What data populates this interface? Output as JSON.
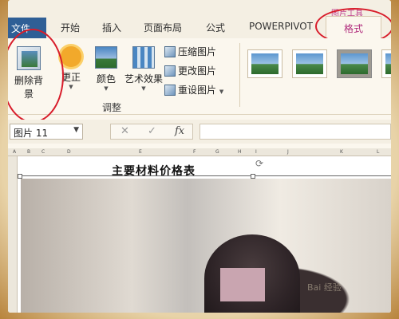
{
  "tabs": {
    "file": "文件",
    "home": "开始",
    "insert": "插入",
    "page_layout": "页面布局",
    "formulas": "公式",
    "powerpivot": "POWERPIVOT",
    "format": "格式",
    "context_title": "图片工具"
  },
  "ribbon": {
    "remove_background": "删除背景",
    "corrections": "更正",
    "color": "颜色",
    "artistic_effects": "艺术效果",
    "compress_pictures": "压缩图片",
    "change_picture": "更改图片",
    "reset_picture": "重设图片",
    "group_adjust": "调整"
  },
  "formula_bar": {
    "name_box": "图片 11",
    "cancel": "✕",
    "enter": "✓",
    "fx": "fx",
    "formula": ""
  },
  "sheet": {
    "column_headers": [
      "A",
      "B",
      "C",
      "D",
      "E",
      "F",
      "G",
      "H",
      "I",
      "J",
      "K",
      "L"
    ],
    "title": "主要材料价格表"
  },
  "watermark": "Bai 经验"
}
